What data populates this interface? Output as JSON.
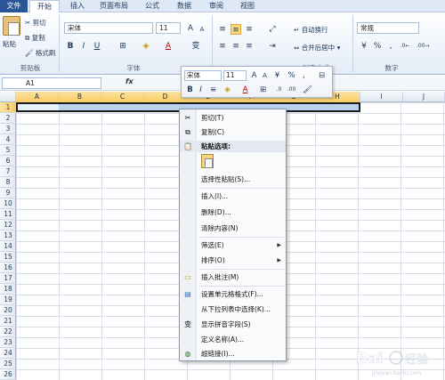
{
  "tabs": [
    "文件",
    "开始",
    "插入",
    "页面布局",
    "公式",
    "数据",
    "审阅",
    "视图"
  ],
  "clipboard": {
    "paste": "粘贴",
    "cut": "剪切",
    "copy": "复制",
    "format_painter": "格式刷",
    "group_label": "剪贴板"
  },
  "font": {
    "name": "宋体",
    "size": "11",
    "group_label": "字体"
  },
  "alignment": {
    "wrap_text": "自动换行",
    "merge_center": "合并后居中",
    "group_label": "对齐方式"
  },
  "number": {
    "format": "常规",
    "percent": "%",
    "comma": ",",
    "group_label": "数字"
  },
  "formula_bar": {
    "name_box": "A1",
    "fx": "fx"
  },
  "grid": {
    "columns": [
      "A",
      "B",
      "C",
      "D",
      "E",
      "F",
      "G",
      "H",
      "I",
      "J"
    ],
    "rows": [
      "1",
      "2",
      "3",
      "4",
      "5",
      "6",
      "7",
      "8",
      "9",
      "10",
      "11",
      "12",
      "13",
      "14",
      "15",
      "16",
      "17",
      "18",
      "19",
      "20",
      "21",
      "22",
      "23",
      "24",
      "25",
      "26"
    ]
  },
  "minibar": {
    "font_name": "宋体",
    "font_size": "11",
    "percent": "%",
    "comma": ","
  },
  "context_menu": {
    "cut": "剪切(T)",
    "copy": "复制(C)",
    "paste_options": "粘贴选项:",
    "paste_special": "选择性粘贴(S)...",
    "insert": "插入(I)...",
    "delete": "删除(D)...",
    "clear_contents": "清除内容(N)",
    "filter": "筛选(E)",
    "sort": "排序(O)",
    "insert_comment": "插入批注(M)",
    "format_cells": "设置单元格格式(F)...",
    "pick_from_list": "从下拉列表中选择(K)...",
    "phonetic": "显示拼音字段(S)",
    "define_name": "定义名称(A)...",
    "hyperlink": "超链接(I)..."
  },
  "colors": {
    "file_tab": "#2a5699",
    "selection": "#b9d2ee",
    "header_highlight": "#f8cc62"
  }
}
